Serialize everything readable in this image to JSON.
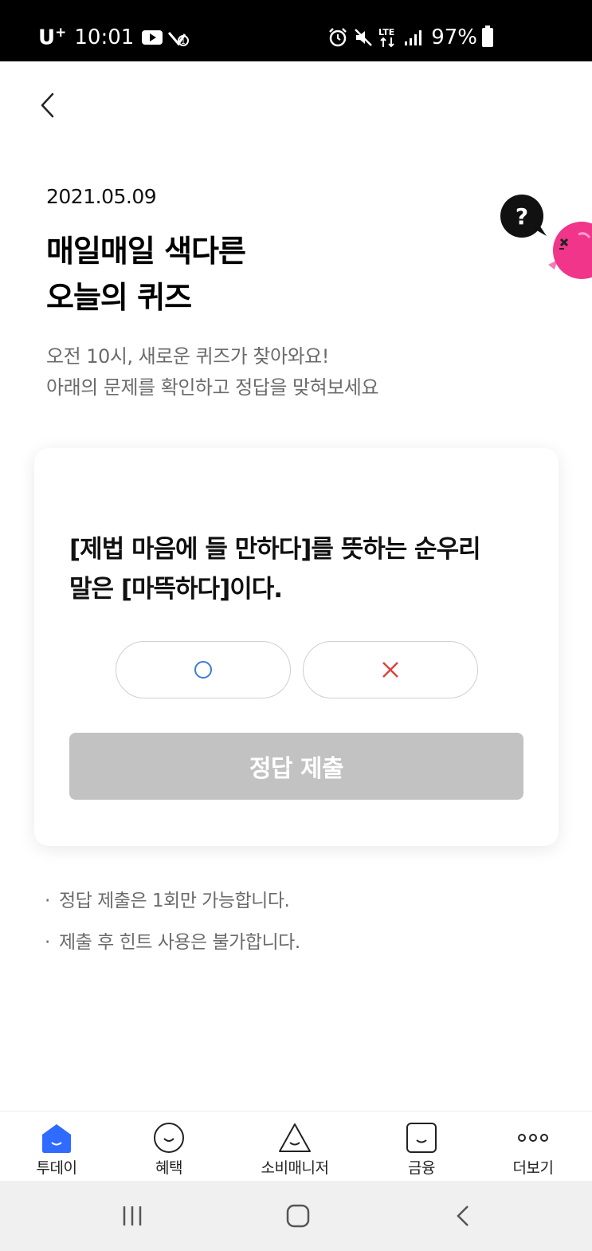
{
  "status_bar": {
    "carrier": "U",
    "carrier_sup": "+",
    "time": "10:01",
    "network": "LTE",
    "battery": "97%",
    "icons": [
      "youtube-icon",
      "wifi-calling-icon",
      "alarm-icon",
      "mute-icon",
      "lte-icon",
      "signal-icon",
      "battery-icon"
    ]
  },
  "header": {
    "back_icon": "chevron-left-icon",
    "date": "2021.05.09",
    "title_line1": "매일매일 색다른",
    "title_line2": "오늘의 퀴즈",
    "subtitle_line1": "오전 10시, 새로운 퀴즈가 찾아와요!",
    "subtitle_line2": "아래의 문제를 확인하고 정답을 맞혀보세요",
    "help_label": "?"
  },
  "quiz": {
    "question_line1": "[제법 마음에 들 만하다]를 뜻하는 순우리",
    "question_line2": "말은 [마뜩하다]이다.",
    "answer_true_icon": "circle-o-icon",
    "answer_false_icon": "x-mark-icon",
    "submit_label": "정답 제출",
    "colors": {
      "o_color": "#3d7bd8",
      "x_color": "#d9453d",
      "submit_bg": "#c2c2c2"
    }
  },
  "notes": [
    {
      "bullet": "·",
      "text": "정답 제출은 1회만 가능합니다."
    },
    {
      "bullet": "·",
      "text": "제출 후 힌트 사용은 불가합니다."
    }
  ],
  "bottom_nav": {
    "active_color": "#2f6bff",
    "items": [
      {
        "label": "투데이",
        "icon": "today-house-icon",
        "active": true
      },
      {
        "label": "혜택",
        "icon": "smile-circle-icon",
        "active": false
      },
      {
        "label": "소비매니저",
        "icon": "triangle-smile-icon",
        "active": false
      },
      {
        "label": "금융",
        "icon": "square-smile-icon",
        "active": false
      },
      {
        "label": "더보기",
        "icon": "more-dots-icon",
        "active": false
      }
    ]
  },
  "system_nav": {
    "items": [
      "recent-apps-icon",
      "home-icon",
      "back-icon"
    ]
  }
}
